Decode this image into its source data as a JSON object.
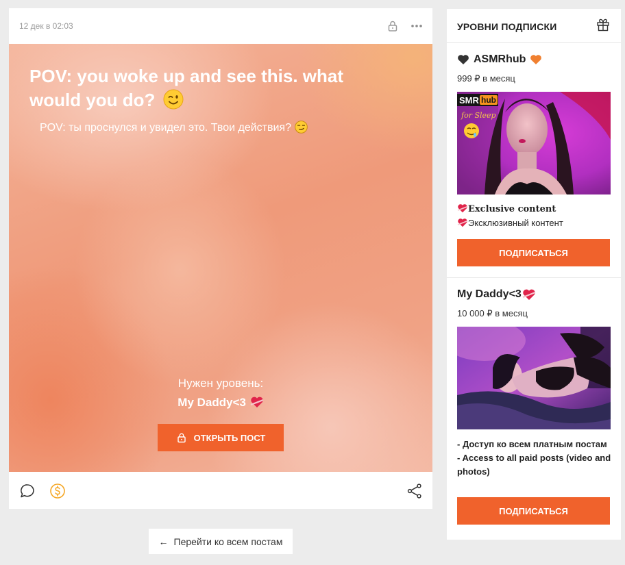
{
  "post": {
    "date": "12 дек в 02:03",
    "title": "POV: you woke up and see this. what would you do?",
    "subtitle": "POV: ты проснулся и увидел это. Твои действия?",
    "need_level_label": "Нужен уровень:",
    "required_tier": "My Daddy<3",
    "open_button": "ОТКРЫТЬ ПОСТ"
  },
  "back_link": "Перейти ко всем постам",
  "tiers": {
    "title": "УРОВНИ ПОДПИСКИ",
    "items": [
      {
        "name": "ASMRhub",
        "price": "999 ₽ в месяц",
        "image_brand": "SMR",
        "image_brand_hub": "hub",
        "image_caption": "for Sleep",
        "desc_lines": [
          "Exclusive content",
          "Эксклюзивный контент"
        ],
        "button": "ПОДПИСАТЬСЯ"
      },
      {
        "name": "My Daddy<3",
        "price": "10 000 ₽ в месяц",
        "desc": "- Доступ ко всем платным постам\n- Access to all paid posts (video and photos)",
        "button": "ПОДПИСАТЬСЯ"
      }
    ]
  },
  "colors": {
    "accent": "#f0622c",
    "donate": "#f5a623",
    "heart_black": "#333333",
    "heart_orange": "#f08030",
    "heart_red": "#e0244a"
  },
  "icons": {
    "lock": "lock-icon",
    "more": "more-icon",
    "comment": "comment-icon",
    "donate": "donate-icon",
    "share": "share-icon",
    "gift": "gift-icon",
    "back": "arrow-left-icon"
  }
}
